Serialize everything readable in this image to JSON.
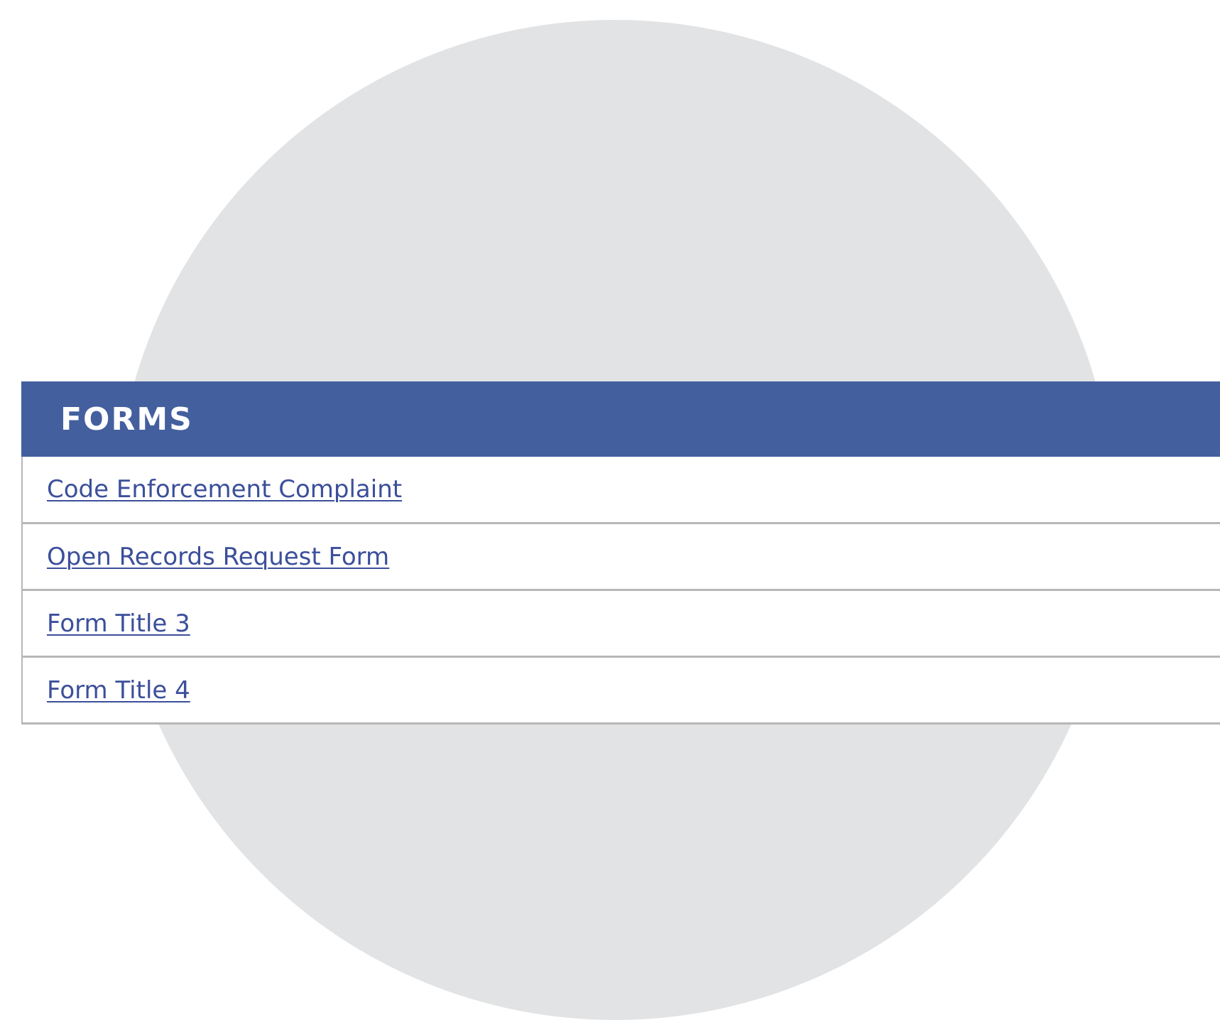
{
  "forms": {
    "title": "FORMS",
    "items": [
      {
        "label": "Code Enforcement Complaint"
      },
      {
        "label": "Open Records Request Form"
      },
      {
        "label": "Form Title 3"
      },
      {
        "label": "Form Title 4"
      }
    ]
  },
  "colors": {
    "header_bg": "#435f9e",
    "link": "#3b4f9a",
    "circle_bg": "#e2e3e5",
    "divider": "#b7b7b7"
  }
}
